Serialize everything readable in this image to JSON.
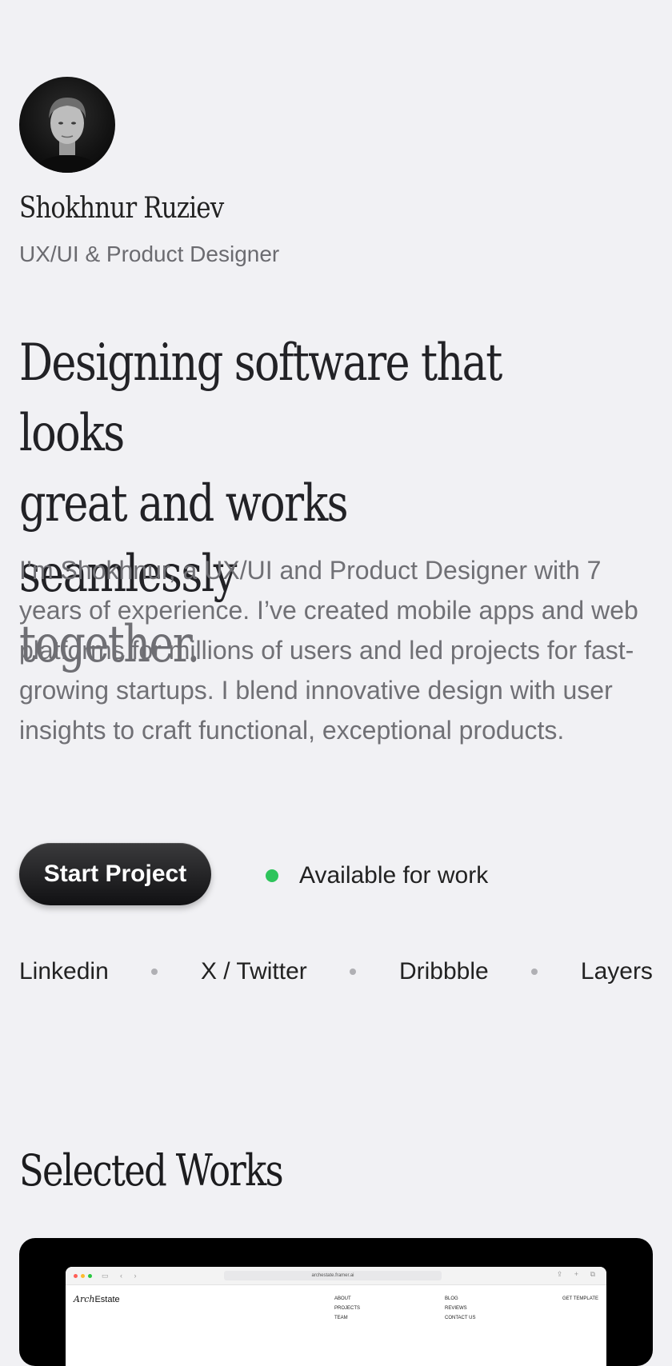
{
  "profile": {
    "name": "Shokhnur Ruziev",
    "role": "UX/UI & Product Designer"
  },
  "hero": {
    "headline_line1": "Designing software that looks",
    "headline_line2": "great and works seamlessly",
    "headline_line3": "together.",
    "bio": "I’m Shokhnur, a UX/UI and Product Designer with 7 years of experience. I’ve created mobile apps and web platforms for millions of users and led projects for fast-growing startups. I blend innovative design with user insights to craft functional, exceptional products."
  },
  "actions": {
    "cta_label": "Start Project",
    "status_label": "Available for work",
    "status_color": "#2ec45b"
  },
  "socials": [
    "Linkedin",
    "X / Twitter",
    "Dribbble",
    "Layers"
  ],
  "works": {
    "title": "Selected Works",
    "preview": {
      "url": "archestate.framer.ai",
      "logo_italic": "Arch",
      "logo_rest": "Estate",
      "nav_col1": [
        "ABOUT",
        "PROJECTS",
        "TEAM"
      ],
      "nav_col2": [
        "BLOG",
        "REVIEWS",
        "CONTACT US"
      ],
      "nav_cta": "GET TEMPLATE"
    }
  }
}
